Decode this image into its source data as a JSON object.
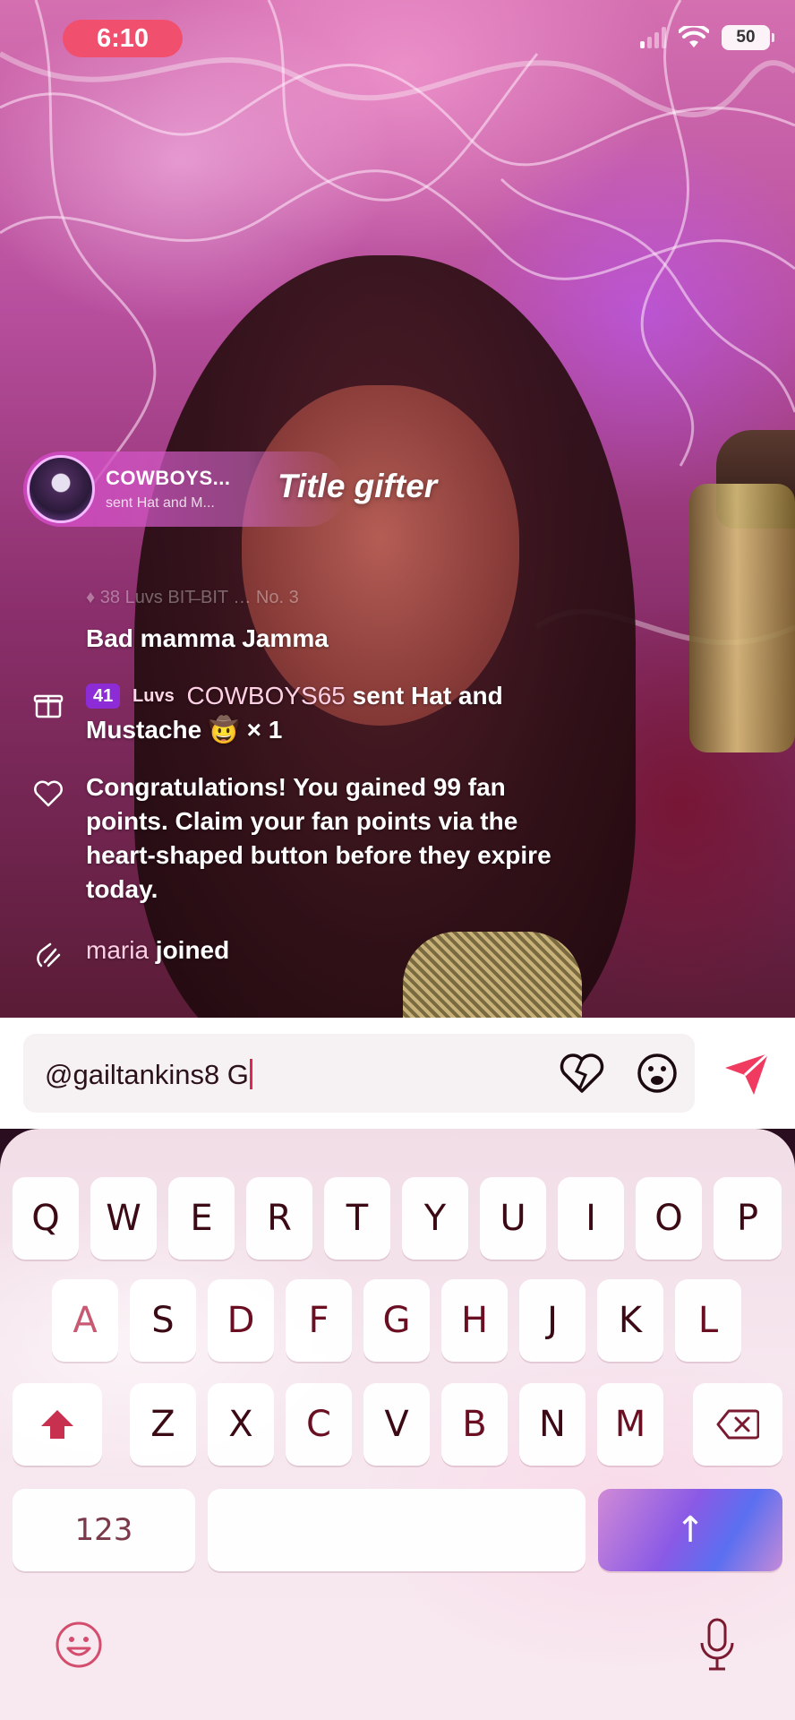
{
  "status": {
    "time": "6:10",
    "battery": "50"
  },
  "gift_banner": {
    "name": "COWBOYS...",
    "subtitle": "sent Hat and M...",
    "title": "Title gifter"
  },
  "chat": {
    "faded_row": "♦ 38  Luvs  BIT̶ BIT  …  No. 3",
    "messages": [
      {
        "text": "Bad mamma Jamma"
      },
      {
        "level": "41",
        "luvs": "Luvs",
        "user": "COWBOYS65",
        "text": " sent Hat and Mustache 🤠 × 1"
      },
      {
        "text": "Congratulations! You gained 99 fan points. Claim your fan points via the heart-shaped button before they expire today."
      },
      {
        "user": "maria",
        "text": " joined"
      }
    ]
  },
  "compose": {
    "value": "@gailtankins8 G"
  },
  "keyboard": {
    "row1": [
      "Q",
      "W",
      "E",
      "R",
      "T",
      "Y",
      "U",
      "I",
      "O",
      "P"
    ],
    "row2": [
      "A",
      "S",
      "D",
      "F",
      "G",
      "H",
      "J",
      "K",
      "L"
    ],
    "row3": [
      "Z",
      "X",
      "C",
      "V",
      "B",
      "N",
      "M"
    ],
    "numbers_label": "123",
    "return_label": "↑"
  },
  "icons": [
    "gift-icon",
    "heart-icon",
    "wave-icon",
    "heart-button-icon",
    "emoji-icon",
    "send-icon",
    "shift-icon",
    "backspace-icon",
    "mic-icon"
  ]
}
